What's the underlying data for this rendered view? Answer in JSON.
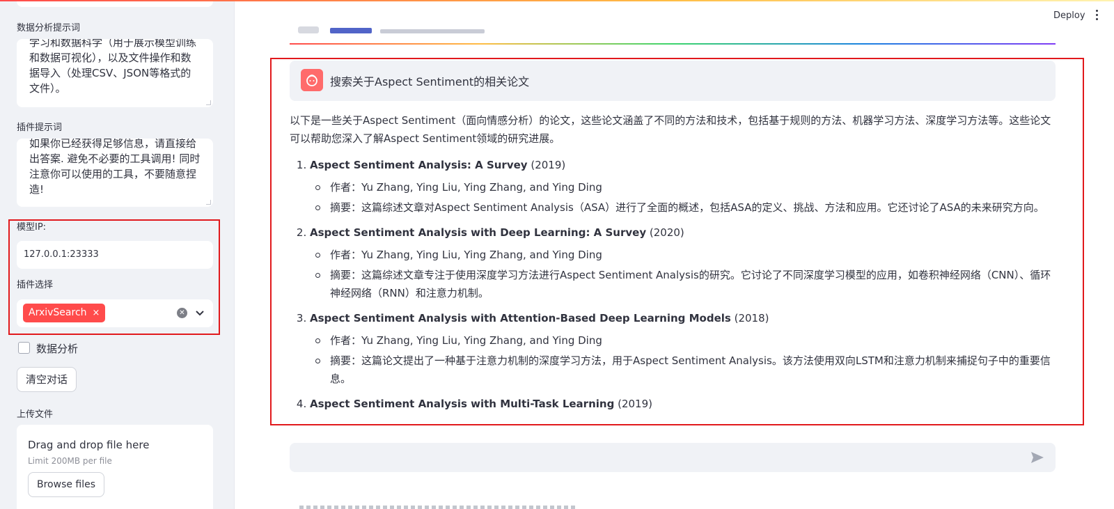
{
  "header": {
    "deploy_label": "Deploy"
  },
  "sidebar": {
    "data_analysis_prompt": {
      "label": "数据分析提示词",
      "value": "学习和数据科学（用于展示模型训练和数据可视化），以及文件操作和数据导入（处理CSV、JSON等格式的文件）。"
    },
    "plugin_prompt": {
      "label": "插件提示词",
      "value": "如果你已经获得足够信息，请直接给出答案. 避免不必要的工具调用! 同时注意你可以使用的工具，不要随意捏造!"
    },
    "model_ip": {
      "label": "模型IP:",
      "value": "127.0.0.1:23333"
    },
    "plugin_select": {
      "label": "插件选择",
      "selected_tag": "ArxivSearch",
      "remove_glyph": "×"
    },
    "data_analysis_checkbox": {
      "label": "数据分析",
      "checked": false
    },
    "clear_chat_label": "清空对话",
    "upload": {
      "label": "上传文件",
      "drop_text": "Drag and drop file here",
      "limit_text": "Limit 200MB per file",
      "browse_label": "Browse files"
    }
  },
  "chat": {
    "user_message": "搜索关于Aspect Sentiment的相关论文",
    "reply": {
      "intro": "以下是一些关于Aspect Sentiment（面向情感分析）的论文，这些论文涵盖了不同的方法和技术，包括基于规则的方法、机器学习方法、深度学习方法等。这些论文可以帮助您深入了解Aspect Sentiment领域的研究进展。",
      "papers": [
        {
          "title": "Aspect Sentiment Analysis: A Survey",
          "year": "(2019)",
          "authors": "作者：Yu Zhang, Ying Liu, Ying Zhang, and Ying Ding",
          "abstract": "摘要：这篇综述文章对Aspect Sentiment Analysis（ASA）进行了全面的概述，包括ASA的定义、挑战、方法和应用。它还讨论了ASA的未来研究方向。"
        },
        {
          "title": "Aspect Sentiment Analysis with Deep Learning: A Survey",
          "year": "(2020)",
          "authors": "作者：Yu Zhang, Ying Liu, Ying Zhang, and Ying Ding",
          "abstract": "摘要：这篇综述文章专注于使用深度学习方法进行Aspect Sentiment Analysis的研究。它讨论了不同深度学习模型的应用，如卷积神经网络（CNN）、循环神经网络（RNN）和注意力机制。"
        },
        {
          "title": "Aspect Sentiment Analysis with Attention-Based Deep Learning Models",
          "year": "(2018)",
          "authors": "作者：Yu Zhang, Ying Liu, Ying Zhang, and Ying Ding",
          "abstract": "摘要：这篇论文提出了一种基于注意力机制的深度学习方法，用于Aspect Sentiment Analysis。该方法使用双向LSTM和注意力机制来捕捉句子中的重要信息。"
        },
        {
          "title": "Aspect Sentiment Analysis with Multi-Task Learning",
          "year": "(2019)"
        }
      ]
    },
    "input_placeholder": ""
  },
  "colors": {
    "accent": "#ff4b4b",
    "highlight_box": "#e1191c",
    "sidebar_bg": "#f0f2f6",
    "text": "#31333f"
  }
}
